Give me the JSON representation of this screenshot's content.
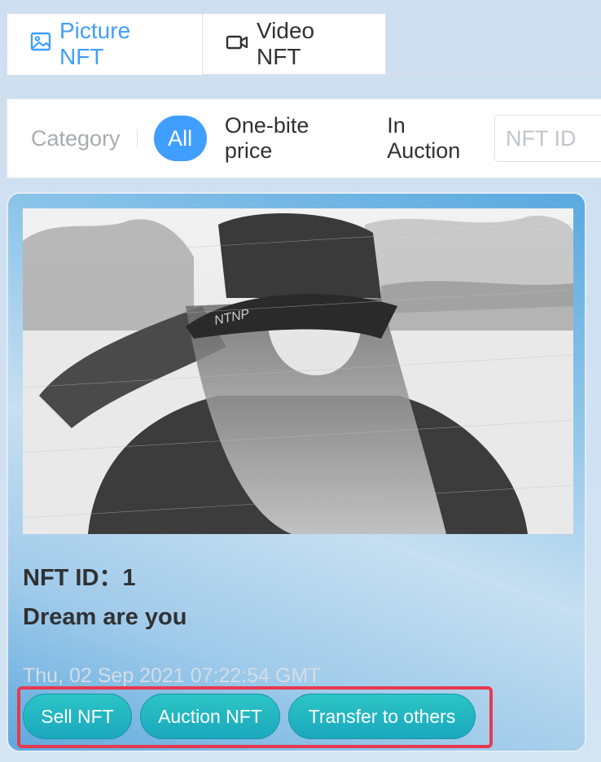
{
  "tabs": [
    {
      "label": "Picture NFT",
      "icon": "image-icon",
      "active": true
    },
    {
      "label": "Video NFT",
      "icon": "video-camera-icon",
      "active": false
    }
  ],
  "filter": {
    "category_label": "Category",
    "options": [
      "All",
      "One-bite price",
      "In Auction"
    ],
    "selected": "All",
    "search_placeholder": "NFT ID",
    "search_value": ""
  },
  "card": {
    "id_line": "NFT ID：1",
    "name": "Dream are you",
    "date": "Thu, 02 Sep 2021 07:22:54 GMT",
    "actions": [
      "Sell NFT",
      "Auction NFT",
      "Transfer to others"
    ]
  },
  "colors": {
    "accent": "#409eff",
    "action_button": "#1aa8bd",
    "highlight_border": "#e6394f"
  }
}
